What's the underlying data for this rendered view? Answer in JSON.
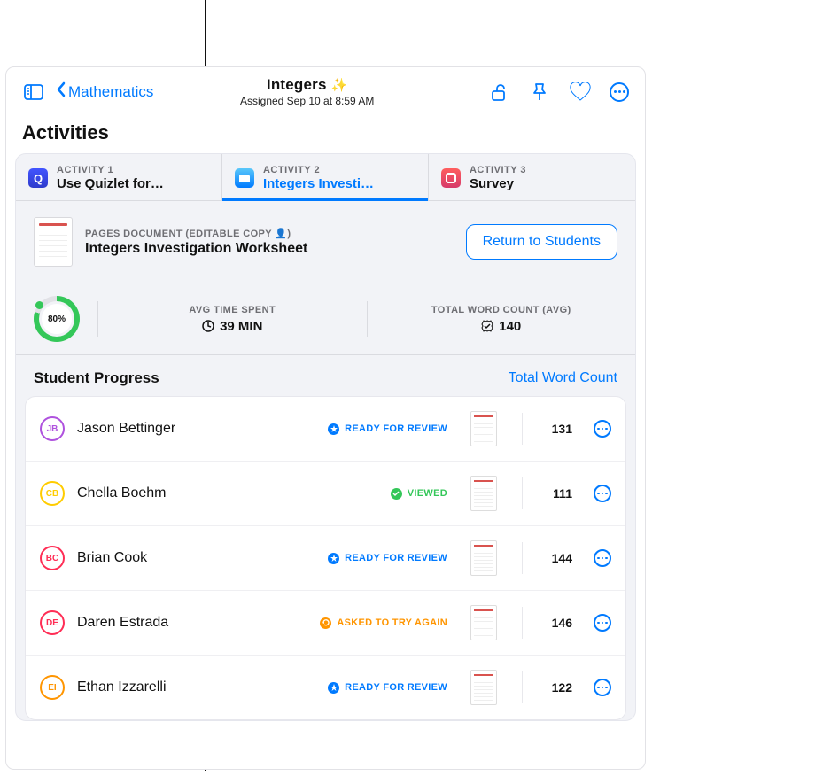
{
  "header": {
    "back_label": "Mathematics",
    "title": "Integers",
    "title_emoji": "✨",
    "subtitle": "Assigned Sep 10 at 8:59 AM"
  },
  "section_title": "Activities",
  "tabs": [
    {
      "tag": "ACTIVITY 1",
      "label": "Use Quizlet for…",
      "icon": "quizlet-app-icon",
      "active": false
    },
    {
      "tag": "ACTIVITY 2",
      "label": "Integers Investi…",
      "icon": "files-app-icon",
      "active": true
    },
    {
      "tag": "ACTIVITY 3",
      "label": "Survey",
      "icon": "survey-app-icon",
      "active": false
    }
  ],
  "document": {
    "caption": "PAGES DOCUMENT (EDITABLE COPY 👤)",
    "name": "Integers Investigation Worksheet",
    "return_button": "Return to Students"
  },
  "stats": {
    "progress_pct": "80%",
    "time_label": "AVG TIME SPENT",
    "time_value": "39 MIN",
    "words_label": "TOTAL WORD COUNT (AVG)",
    "words_value": "140"
  },
  "progress_header": {
    "title": "Student Progress",
    "link": "Total Word Count"
  },
  "status_text": {
    "ready": "READY FOR REVIEW",
    "viewed": "VIEWED",
    "try_again": "ASKED TO TRY AGAIN"
  },
  "students": [
    {
      "initials": "JB",
      "name": "Jason Bettinger",
      "status": "ready",
      "ring": "#AF52DE",
      "count": "131"
    },
    {
      "initials": "CB",
      "name": "Chella Boehm",
      "status": "viewed",
      "ring": "#FFCC00",
      "count": "111"
    },
    {
      "initials": "BC",
      "name": "Brian Cook",
      "status": "ready",
      "ring": "#FF2D55",
      "count": "144"
    },
    {
      "initials": "DE",
      "name": "Daren Estrada",
      "status": "try_again",
      "ring": "#FF2D55",
      "count": "146"
    },
    {
      "initials": "EI",
      "name": "Ethan Izzarelli",
      "status": "ready",
      "ring": "#FF9500",
      "count": "122"
    }
  ]
}
